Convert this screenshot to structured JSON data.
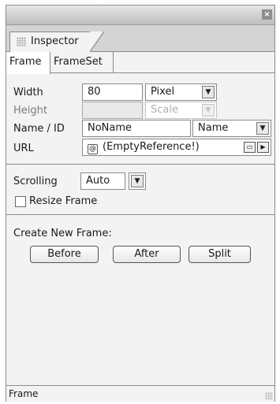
{
  "window": {
    "close_label": "×",
    "tab_title": "Inspector"
  },
  "subtabs": [
    {
      "label": "Frame",
      "active": true
    },
    {
      "label": "FrameSet",
      "active": false
    }
  ],
  "size": {
    "width_label": "Width",
    "width_value": "80",
    "width_unit": "Pixel",
    "height_label": "Height",
    "height_value": "",
    "height_unit": "Scale"
  },
  "name_id": {
    "label": "Name / ID",
    "value": "NoName",
    "mode": "Name"
  },
  "url": {
    "label": "URL",
    "icon": "@",
    "value": "(EmptyReference!)"
  },
  "scrolling": {
    "label": "Scrolling",
    "value": "Auto"
  },
  "resize": {
    "label": "Resize Frame",
    "checked": false
  },
  "create_frame": {
    "label": "Create New Frame:",
    "buttons": [
      "Before",
      "After",
      "Split"
    ]
  },
  "status_text": "Frame",
  "icons": {
    "dropdown": "chevron-down-icon",
    "browse": "folder-icon",
    "navigate": "arrow-right-icon",
    "close": "close-icon",
    "url": "at-sign-icon"
  }
}
